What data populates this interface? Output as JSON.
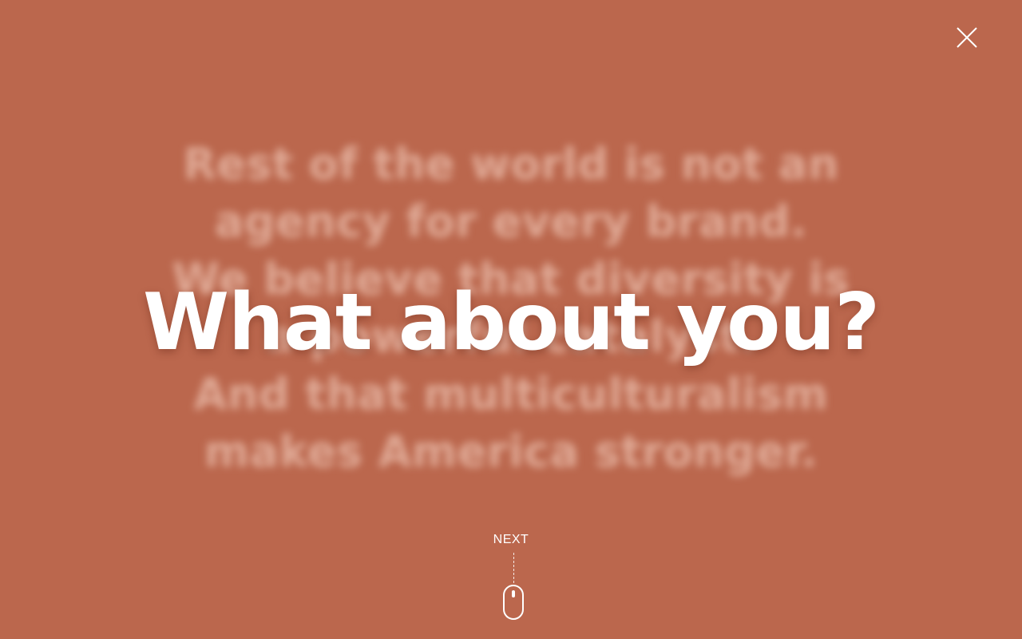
{
  "background_color": "#bb674d",
  "background_text": {
    "lines": [
      "Rest of the world is not an",
      "agency for every brand.",
      "We believe that diversity is",
      "a powerful catalyst.",
      "And that multiculturalism",
      "makes America stronger."
    ]
  },
  "headline": "What about you?",
  "close_button": {
    "icon": "close-icon",
    "color": "#ffffff"
  },
  "next": {
    "label": "NEXT",
    "icon": "mouse-scroll-icon"
  }
}
